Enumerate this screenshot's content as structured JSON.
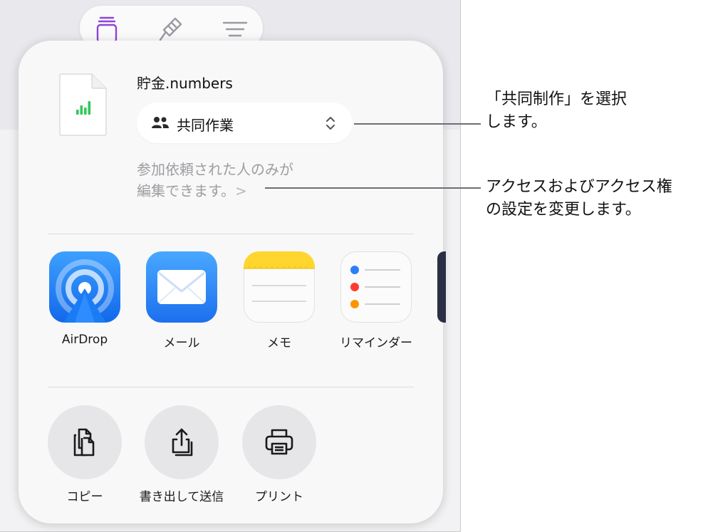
{
  "file": {
    "name": "貯金.numbers"
  },
  "collaboration": {
    "selected": "共同作業"
  },
  "access": {
    "line1": "参加依頼された人のみが",
    "line2": "編集できます。",
    "chevron": ">"
  },
  "apps": [
    {
      "label": "AirDrop",
      "icon": "airdrop-icon"
    },
    {
      "label": "メール",
      "icon": "mail-icon"
    },
    {
      "label": "メモ",
      "icon": "notes-icon"
    },
    {
      "label": "リマインダー",
      "icon": "reminders-icon"
    }
  ],
  "actions": [
    {
      "label": "コピー",
      "icon": "copy-icon"
    },
    {
      "label": "書き出して送信",
      "icon": "export-icon"
    },
    {
      "label": "プリント",
      "icon": "print-icon"
    }
  ],
  "callouts": {
    "collab": {
      "line1": "「共同制作」を選択",
      "line2": "します。"
    },
    "access": {
      "line1": "アクセスおよびアクセス権",
      "line2": "の設定を変更します。"
    }
  },
  "colors": {
    "accent": "#8e44d8",
    "numbers_green": "#34c759",
    "airdrop_blue": "#1a7cf5",
    "mail_blue": "#2d8bf0",
    "notes_yellow": "#ffd52e"
  }
}
